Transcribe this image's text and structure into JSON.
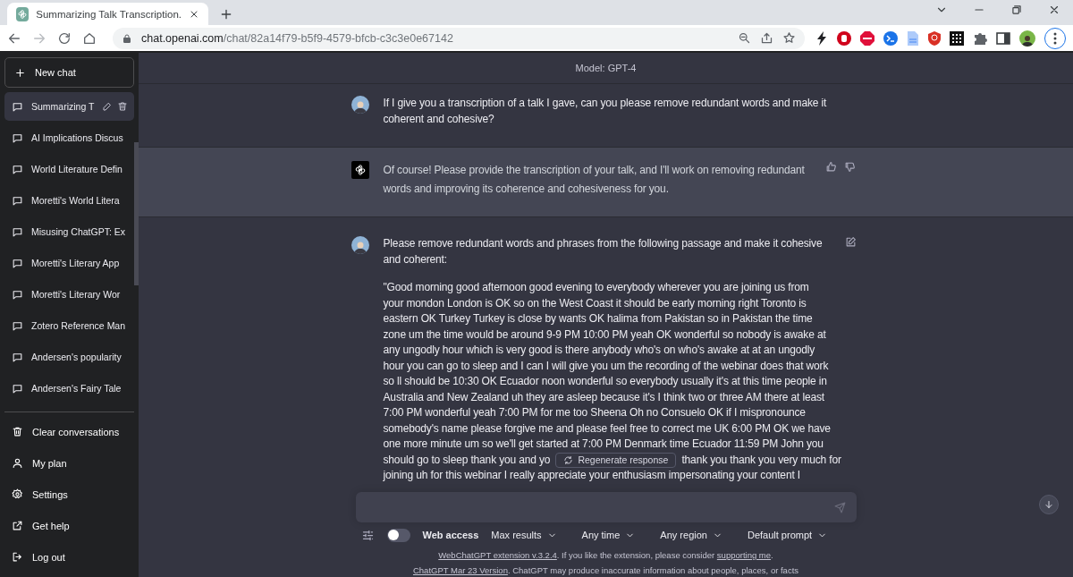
{
  "browser": {
    "tab": {
      "title": "Summarizing Talk Transcription."
    },
    "forward": {
      "disabled": true
    },
    "url": {
      "host": "chat.openai.com",
      "path": "/chat/82a14f79-b5f9-4579-bfcb-c3c3e0e67142"
    }
  },
  "sidebar": {
    "new_chat": "New chat",
    "conversations": [
      {
        "title": "Summarizing T",
        "selected": true
      },
      {
        "title": "AI Implications Discus",
        "selected": false
      },
      {
        "title": "World Literature Defin",
        "selected": false
      },
      {
        "title": "Moretti's World Litera",
        "selected": false
      },
      {
        "title": "Misusing ChatGPT: Ex",
        "selected": false
      },
      {
        "title": "Moretti's Literary App",
        "selected": false
      },
      {
        "title": "Moretti's Literary Wor",
        "selected": false
      },
      {
        "title": "Zotero Reference Man",
        "selected": false
      },
      {
        "title": "Andersen's popularity",
        "selected": false
      },
      {
        "title": "Andersen's Fairy Tale",
        "selected": false
      }
    ],
    "menu": [
      {
        "label": "Clear conversations",
        "kind": "trash"
      },
      {
        "label": "My plan",
        "kind": "user"
      },
      {
        "label": "Settings",
        "kind": "gear"
      },
      {
        "label": "Get help",
        "kind": "external"
      },
      {
        "label": "Log out",
        "kind": "logout"
      }
    ]
  },
  "model_bar": "Model: GPT-4",
  "messages": [
    {
      "kind": "user",
      "edit": false,
      "blocks": [
        {
          "kind": "paragraph",
          "lines": [
            "If I give you a transcription of a talk I gave, can you please remove redundant words and make it",
            "coherent and cohesive?"
          ]
        }
      ]
    },
    {
      "kind": "assistant",
      "edit": false,
      "blocks": [
        {
          "kind": "paragraph",
          "lines": [
            "Of course! Please provide the transcription of your talk, and I'll work on removing redundant",
            "words and improving its coherence and cohesiveness for you."
          ]
        }
      ]
    },
    {
      "kind": "user",
      "edit": true,
      "blocks": [
        {
          "kind": "paragraph",
          "lines": [
            "Please remove redundant words and phrases from the following passage and make it cohesive",
            "and coherent:"
          ]
        },
        {
          "kind": "paragraph",
          "lines": [
            "\"Good morning good afternoon good evening to everybody wherever you are joining us from",
            "your mondon London is OK so on the West Coast it should be early morning right Toronto is",
            "eastern OK Turkey Turkey is close by wants OK halima from Pakistan so in Pakistan the time",
            "zone um the time would be around 9-9 PM 10:00 PM yeah OK wonderful so nobody is awake at",
            "any ungodly hour which is very good is there anybody who's on who's awake at at an ungodly",
            "hour you can go to sleep and I can I will give you um the recording of the webinar does that work",
            "so ll should be 10:30 OK Ecuador noon wonderful so everybody usually it's at this time people in",
            "Australia and New Zealand uh they are asleep because it's I think two or three AM there at least",
            "7:00 PM wonderful yeah 7:00 PM for me too Sheena Oh no Consuelo OK if I mispronounce",
            "somebody's name please forgive me and please feel free to correct me UK 6:00 PM OK we have",
            "one more minute um so we'll get started at 7:00 PM Denmark time Ecuador 11:59 PM John you"
          ]
        },
        {
          "kind": "regenerate_row",
          "left": "should go to sleep thank you and yo",
          "right": "thank you thank you very much for"
        },
        {
          "kind": "continued",
          "lines": [
            "joining uh for this webinar I really appreciate your enthusiasm impersonating your content I"
          ]
        }
      ]
    }
  ],
  "composer": {
    "regenerate": "Regenerate response",
    "web_access": {
      "label": "Web access",
      "on": false
    },
    "dropdowns": [
      "Max results",
      "Any time",
      "Any region",
      "Default prompt"
    ],
    "notes": [
      [
        {
          "kind": "link",
          "text": "WebChatGPT extension v.3.2.4"
        },
        {
          "kind": "text",
          "text": ". If you like the extension, please consider "
        },
        {
          "kind": "link",
          "text": "supporting me"
        },
        {
          "kind": "text",
          "text": "."
        }
      ],
      [
        {
          "kind": "link",
          "text": "ChatGPT Mar 23 Version"
        },
        {
          "kind": "text",
          "text": ". ChatGPT may produce inaccurate information about people, places, or facts"
        }
      ]
    ]
  }
}
